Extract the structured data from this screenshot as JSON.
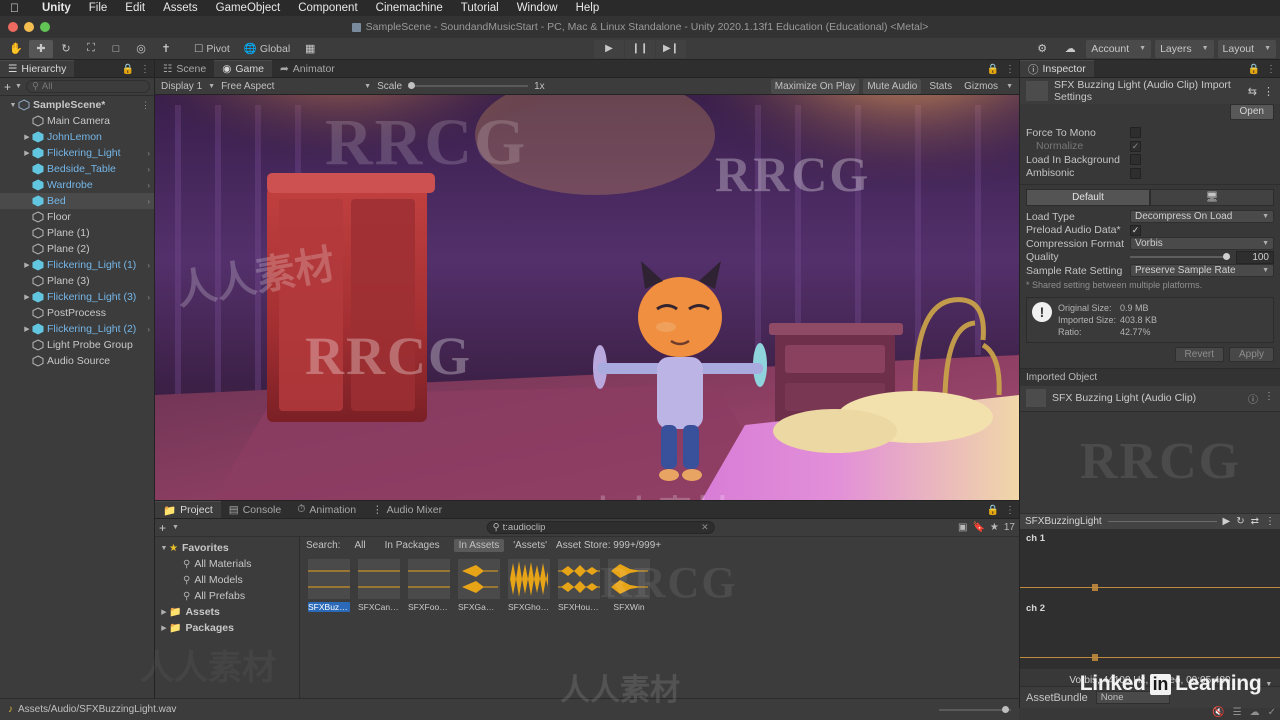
{
  "menubar": {
    "apple": "apple-logo",
    "items": [
      "Unity",
      "File",
      "Edit",
      "Assets",
      "GameObject",
      "Component",
      "Cinemachine",
      "Tutorial",
      "Window",
      "Help"
    ]
  },
  "window": {
    "title": "SampleScene - SoundandMusicStart - PC, Mac & Linux Standalone - Unity 2020.1.13f1 Education (Educational) <Metal>"
  },
  "toolbar": {
    "tools": [
      "hand-tool",
      "move-tool",
      "rotate-tool",
      "scale-tool",
      "rect-tool",
      "transform-tool",
      "custom-tool"
    ],
    "pivot_label": "Pivot",
    "global_label": "Global",
    "play_label": "▶",
    "pause_label": "❙❙",
    "step_label": "▶❙",
    "account_label": "Account",
    "layers_label": "Layers",
    "layout_label": "Layout"
  },
  "hierarchy": {
    "tab_label": "Hierarchy",
    "search_placeholder": "All",
    "items": [
      {
        "label": "SampleScene*",
        "depth": 0,
        "expanded": true,
        "type": "scene",
        "selected": false,
        "highlight": false,
        "menu": true
      },
      {
        "label": "Main Camera",
        "depth": 1,
        "expanded": false,
        "type": "object",
        "selected": false,
        "highlight": false
      },
      {
        "label": "JohnLemon",
        "depth": 1,
        "expanded": false,
        "type": "prefab",
        "selected": false,
        "highlight": true,
        "arrow": true
      },
      {
        "label": "Flickering_Light",
        "depth": 1,
        "expanded": false,
        "type": "prefab",
        "selected": false,
        "highlight": true,
        "arrow": true,
        "chevron": true
      },
      {
        "label": "Bedside_Table",
        "depth": 1,
        "expanded": false,
        "type": "prefab",
        "selected": false,
        "highlight": true,
        "chevron": true
      },
      {
        "label": "Wardrobe",
        "depth": 1,
        "expanded": false,
        "type": "prefab",
        "selected": false,
        "highlight": true,
        "chevron": true
      },
      {
        "label": "Bed",
        "depth": 1,
        "expanded": false,
        "type": "prefab",
        "selected": true,
        "highlight": true,
        "chevron": true
      },
      {
        "label": "Floor",
        "depth": 1,
        "expanded": false,
        "type": "object",
        "selected": false,
        "highlight": false
      },
      {
        "label": "Plane (1)",
        "depth": 1,
        "expanded": false,
        "type": "object",
        "selected": false,
        "highlight": false
      },
      {
        "label": "Plane (2)",
        "depth": 1,
        "expanded": false,
        "type": "object",
        "selected": false,
        "highlight": false
      },
      {
        "label": "Flickering_Light (1)",
        "depth": 1,
        "expanded": false,
        "type": "prefab",
        "selected": false,
        "highlight": true,
        "arrow": true,
        "chevron": true
      },
      {
        "label": "Plane (3)",
        "depth": 1,
        "expanded": false,
        "type": "object",
        "selected": false,
        "highlight": false
      },
      {
        "label": "Flickering_Light (3)",
        "depth": 1,
        "expanded": false,
        "type": "prefab",
        "selected": false,
        "highlight": true,
        "arrow": true,
        "chevron": true
      },
      {
        "label": "PostProcess",
        "depth": 1,
        "expanded": false,
        "type": "object",
        "selected": false,
        "highlight": false
      },
      {
        "label": "Flickering_Light (2)",
        "depth": 1,
        "expanded": false,
        "type": "prefab",
        "selected": false,
        "highlight": true,
        "arrow": true,
        "chevron": true
      },
      {
        "label": "Light Probe Group",
        "depth": 1,
        "expanded": false,
        "type": "object",
        "selected": false,
        "highlight": false
      },
      {
        "label": "Audio Source",
        "depth": 1,
        "expanded": false,
        "type": "object",
        "selected": false,
        "highlight": false
      }
    ]
  },
  "center": {
    "tabs": [
      {
        "label": "Scene",
        "icon": "scene-icon",
        "active": false
      },
      {
        "label": "Game",
        "icon": "game-icon",
        "active": true
      },
      {
        "label": "Animator",
        "icon": "animator-icon",
        "active": false
      }
    ],
    "game_toolbar": {
      "display": "Display 1",
      "aspect": "Free Aspect",
      "scale_label": "Scale",
      "scale_value": "1x",
      "maximize_on_play": "Maximize On Play",
      "mute_audio": "Mute Audio",
      "stats": "Stats",
      "gizmos": "Gizmos"
    }
  },
  "project": {
    "tabs": [
      {
        "label": "Project",
        "icon": "folder-icon",
        "active": true
      },
      {
        "label": "Console",
        "icon": "console-icon",
        "active": false
      },
      {
        "label": "Animation",
        "icon": "animation-icon",
        "active": false
      },
      {
        "label": "Audio Mixer",
        "icon": "audio-mixer-icon",
        "active": false
      }
    ],
    "search_value": "t:audioclip",
    "result_count": "17",
    "tree": [
      {
        "label": "Favorites",
        "depth": 0,
        "icon": "star-icon",
        "expanded": true
      },
      {
        "label": "All Materials",
        "depth": 1,
        "icon": "search-icon"
      },
      {
        "label": "All Models",
        "depth": 1,
        "icon": "search-icon"
      },
      {
        "label": "All Prefabs",
        "depth": 1,
        "icon": "search-icon"
      },
      {
        "label": "Assets",
        "depth": 0,
        "icon": "folder-icon",
        "collapsed": true
      },
      {
        "label": "Packages",
        "depth": 0,
        "icon": "folder-icon",
        "collapsed": true
      }
    ],
    "filter": {
      "search_label": "Search:",
      "chips": [
        {
          "label": "All",
          "on": false
        },
        {
          "label": "In Packages",
          "on": false
        },
        {
          "label": "In Assets",
          "on": true
        }
      ],
      "path_label": "'Assets'",
      "asset_store": "Asset Store: 999+/999+"
    },
    "assets": [
      {
        "name": "SFXBuzzin...",
        "wave": "flat",
        "selected": true
      },
      {
        "name": "SFXCandle",
        "wave": "flat",
        "selected": false
      },
      {
        "name": "SFXFootst...",
        "wave": "flat",
        "selected": false
      },
      {
        "name": "SFXGame...",
        "wave": "arrow",
        "selected": false
      },
      {
        "name": "SFXGhost...",
        "wave": "dense",
        "selected": false
      },
      {
        "name": "SFXHouse...",
        "wave": "spiky",
        "selected": false
      },
      {
        "name": "SFXWin",
        "wave": "taper",
        "selected": false
      }
    ]
  },
  "statusbar": {
    "path": "Assets/Audio/SFXBuzzingLight.wav",
    "icon": "audio-note-icon"
  },
  "inspector": {
    "tab_label": "Inspector",
    "asset_title": "SFX Buzzing Light  (Audio Clip) Import Settings",
    "open_label": "Open",
    "toggles": [
      {
        "label": "Force To Mono",
        "checked": false,
        "dim": false
      },
      {
        "label": "Normalize",
        "checked": true,
        "dim": true
      },
      {
        "label": "Load In Background",
        "checked": false,
        "dim": false
      },
      {
        "label": "Ambisonic",
        "checked": false,
        "dim": false
      }
    ],
    "platform_tabs": [
      {
        "label": "Default",
        "active": true
      },
      {
        "label": "",
        "icon": "standalone-icon",
        "active": false
      }
    ],
    "settings": [
      {
        "label": "Load Type",
        "value": "Decompress On Load",
        "type": "dropdown"
      },
      {
        "label": "Preload Audio Data*",
        "value": "",
        "type": "checkbox",
        "checked": true
      },
      {
        "label": "Compression Format",
        "value": "Vorbis",
        "type": "dropdown"
      },
      {
        "label": "Quality",
        "value": "100",
        "type": "slider"
      },
      {
        "label": "Sample Rate Setting",
        "value": "Preserve Sample Rate",
        "type": "dropdown"
      }
    ],
    "note": "* Shared setting between multiple platforms.",
    "stats": [
      {
        "key": "Original Size:",
        "value": "0.9 MB"
      },
      {
        "key": "Imported Size:",
        "value": "403.8 KB"
      },
      {
        "key": "Ratio:",
        "value": "42.77%"
      }
    ],
    "revert_label": "Revert",
    "apply_label": "Apply",
    "imported_object_label": "Imported Object",
    "imported_object_name": "SFX Buzzing Light  (Audio Clip)",
    "clip_name": "SFXBuzzingLight",
    "clip_controls": [
      "play-icon",
      "loop-icon",
      "autoplay-icon",
      "menu-icon"
    ],
    "channels": [
      "ch 1",
      "ch 2"
    ],
    "clip_info": "Vorbis, 44100 Hz, Stereo, 00:05.480",
    "assetbundle_label": "AssetBundle",
    "assetbundle_value": "None"
  },
  "watermarks": {
    "brand": "RRCG",
    "chinese": "人人素材",
    "linkedin": "Linked",
    "linkedin_in": "in",
    "linkedin_learning": "Learning"
  },
  "colors": {
    "accent_blue": "#2a6ab8",
    "panel_bg": "#3c3c3c",
    "toolbar_bg": "#414141",
    "wave_orange": "#c08b3e",
    "hierarchy_blue": "#75b6e8"
  }
}
